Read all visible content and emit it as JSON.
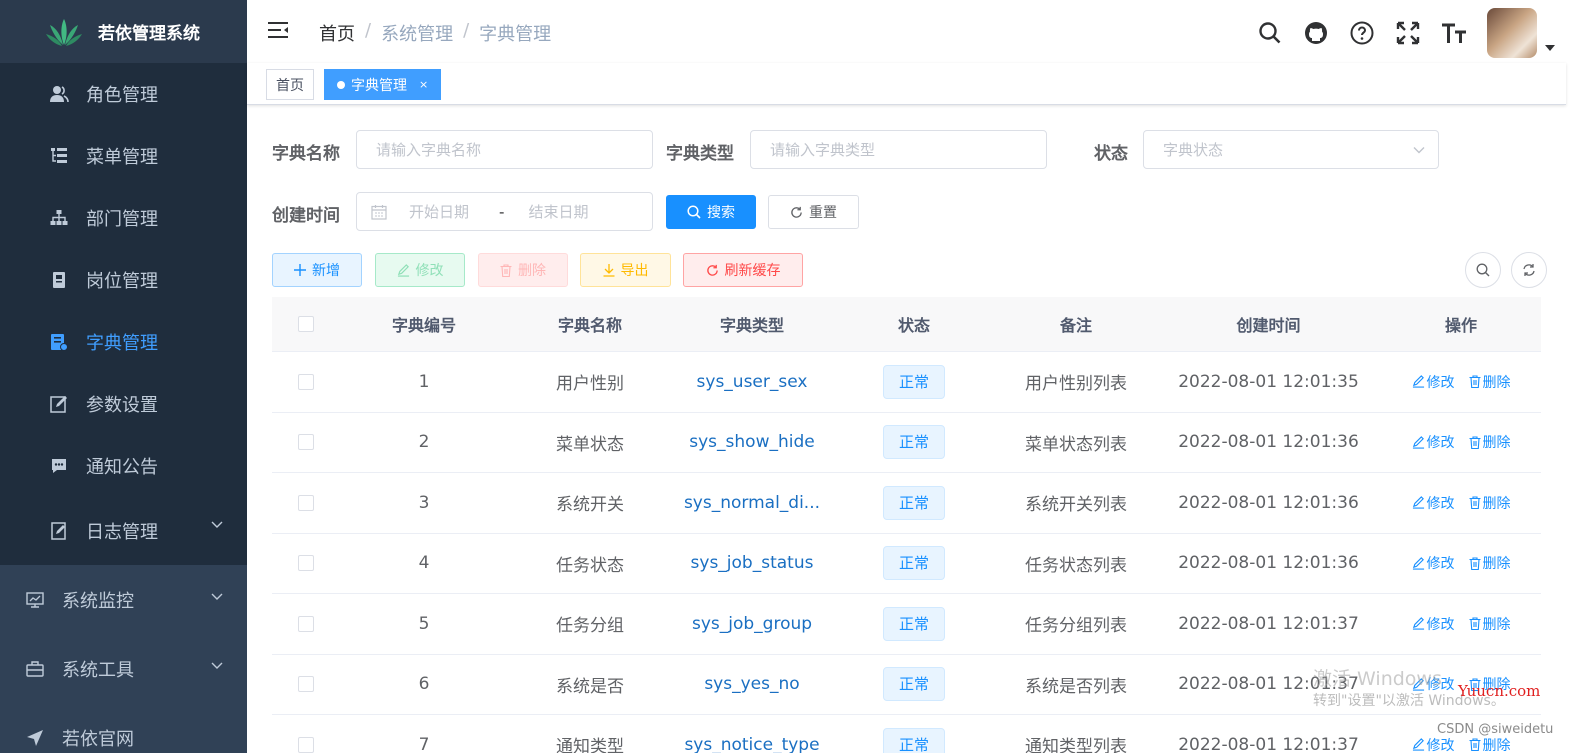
{
  "app": {
    "title": "若依管理系统"
  },
  "sidebar": {
    "items": [
      {
        "label": "角色管理",
        "icon": "peoples-icon"
      },
      {
        "label": "菜单管理",
        "icon": "tree-table-icon"
      },
      {
        "label": "部门管理",
        "icon": "tree-icon"
      },
      {
        "label": "岗位管理",
        "icon": "post-icon"
      },
      {
        "label": "字典管理",
        "icon": "dict-icon",
        "active": true
      },
      {
        "label": "参数设置",
        "icon": "edit-icon"
      },
      {
        "label": "通知公告",
        "icon": "message-icon"
      },
      {
        "label": "日志管理",
        "icon": "log-icon"
      }
    ],
    "top": [
      {
        "label": "系统监控",
        "icon": "monitor-icon"
      },
      {
        "label": "系统工具",
        "icon": "tool-icon"
      },
      {
        "label": "若依官网",
        "icon": "guide-icon"
      }
    ]
  },
  "breadcrumb": {
    "home": "首页",
    "level1": "系统管理",
    "level2": "字典管理",
    "sep": "/"
  },
  "tags": {
    "home": "首页",
    "active": "字典管理",
    "close": "×"
  },
  "form": {
    "dict_name_label": "字典名称",
    "dict_name_placeholder": "请输入字典名称",
    "dict_type_label": "字典类型",
    "dict_type_placeholder": "请输入字典类型",
    "status_label": "状态",
    "status_placeholder": "字典状态",
    "created_label": "创建时间",
    "start_placeholder": "开始日期",
    "range_sep": "-",
    "end_placeholder": "结束日期",
    "search": "搜索",
    "reset": "重置"
  },
  "toolbar": {
    "add": "新增",
    "edit": "修改",
    "delete": "删除",
    "export": "导出",
    "refresh_cache": "刷新缓存"
  },
  "table": {
    "headers": [
      "字典编号",
      "字典名称",
      "字典类型",
      "状态",
      "备注",
      "创建时间",
      "操作"
    ],
    "edit_label": "修改",
    "delete_label": "删除",
    "rows": [
      {
        "id": "1",
        "name": "用户性别",
        "type": "sys_user_sex",
        "status": "正常",
        "remark": "用户性别列表",
        "created": "2022-08-01 12:01:35"
      },
      {
        "id": "2",
        "name": "菜单状态",
        "type": "sys_show_hide",
        "status": "正常",
        "remark": "菜单状态列表",
        "created": "2022-08-01 12:01:36"
      },
      {
        "id": "3",
        "name": "系统开关",
        "type": "sys_normal_di...",
        "status": "正常",
        "remark": "系统开关列表",
        "created": "2022-08-01 12:01:36"
      },
      {
        "id": "4",
        "name": "任务状态",
        "type": "sys_job_status",
        "status": "正常",
        "remark": "任务状态列表",
        "created": "2022-08-01 12:01:36"
      },
      {
        "id": "5",
        "name": "任务分组",
        "type": "sys_job_group",
        "status": "正常",
        "remark": "任务分组列表",
        "created": "2022-08-01 12:01:37"
      },
      {
        "id": "6",
        "name": "系统是否",
        "type": "sys_yes_no",
        "status": "正常",
        "remark": "系统是否列表",
        "created": "2022-08-01 12:01:37"
      },
      {
        "id": "7",
        "name": "通知类型",
        "type": "sys_notice_type",
        "status": "正常",
        "remark": "通知类型列表",
        "created": "2022-08-01 12:01:37"
      }
    ]
  },
  "watermark": {
    "line1": "激活 Windows",
    "line2": "转到\"设置\"以激活 Windows。",
    "site": "Yuucn.com",
    "credit": "CSDN @siweidetu"
  },
  "colors": {
    "sidebar_bg": "#304156",
    "submenu_bg": "#1f2d3d",
    "accent": "#409eff",
    "primary": "#1890ff"
  }
}
